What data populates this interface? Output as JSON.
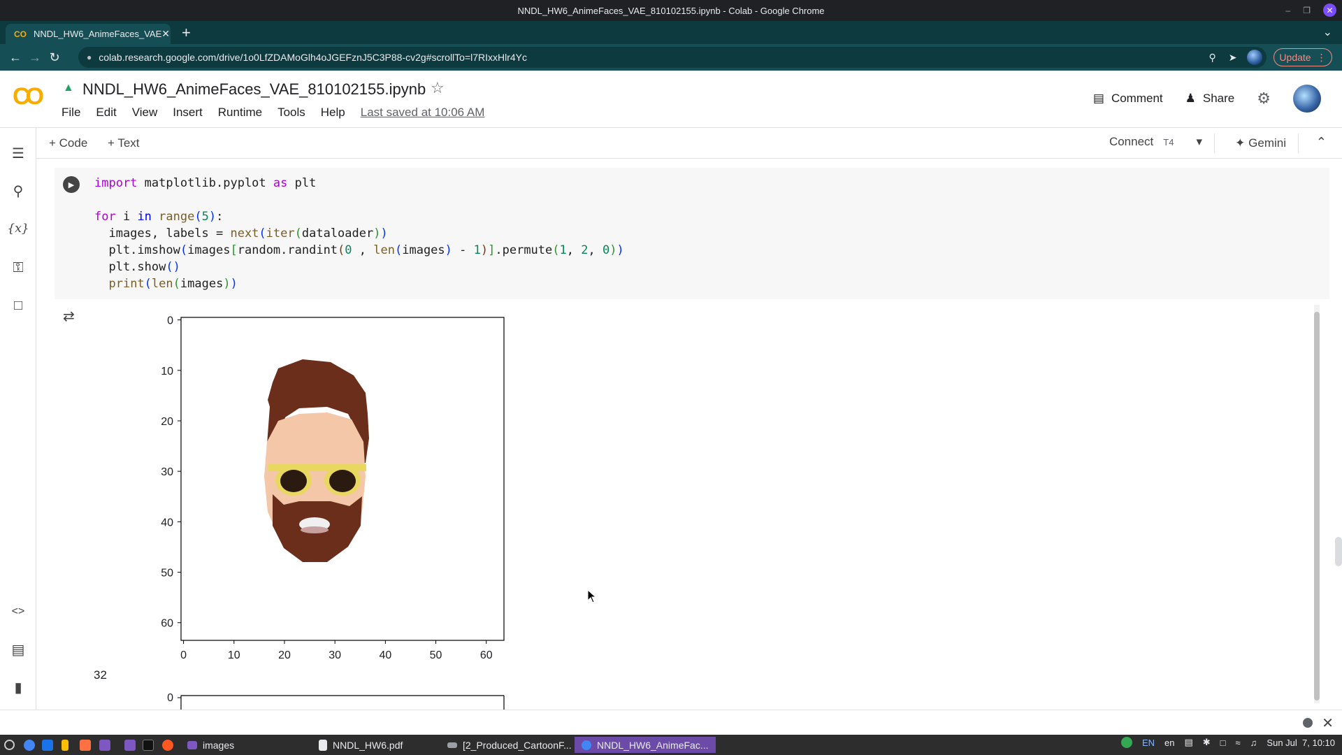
{
  "window": {
    "title": "NNDL_HW6_AnimeFaces_VAE_810102155.ipynb - Colab - Google Chrome",
    "tab_title": "NNDL_HW6_AnimeFaces_VAE",
    "url": "colab.research.google.com/drive/1o0LfZDAMoGlh4oJGEFznJ5C3P88-cv2g#scrollTo=l7RIxxHlr4Yc",
    "update_label": "Update"
  },
  "colab": {
    "notebook_title": "NNDL_HW6_AnimeFaces_VAE_810102155.ipynb",
    "menu": [
      "File",
      "Edit",
      "View",
      "Insert",
      "Runtime",
      "Tools",
      "Help"
    ],
    "last_saved": "Last saved at 10:06 AM",
    "comment_label": "Comment",
    "share_label": "Share"
  },
  "toolbar": {
    "add_code": "+ Code",
    "add_text": "+ Text",
    "connect_label": "Connect",
    "runtime_type": "T4",
    "gemini_label": "Gemini"
  },
  "cell": {
    "code_lines": [
      "import matplotlib.pyplot as plt",
      "",
      "for i in range(5):",
      "  images, labels = next(iter(dataloader))",
      "  plt.imshow(images[random.randint(0 , len(images) - 1)].permute(1, 2, 0))",
      "  plt.show()",
      "  print(len(images))"
    ]
  },
  "chart_data": {
    "type": "heatmap",
    "description_kind": "imshow",
    "xticks": [
      "0",
      "10",
      "20",
      "30",
      "40",
      "50",
      "60"
    ],
    "yticks": [
      "0",
      "10",
      "20",
      "30",
      "40",
      "50",
      "60"
    ],
    "xlim": [
      0,
      63
    ],
    "ylim": [
      63,
      0
    ],
    "second_plot_ytick": "0"
  },
  "output": {
    "printed_value": "32"
  },
  "taskbar": {
    "items": [
      "images",
      "NNDL_HW6.pdf",
      "[2_Produced_CartoonF...",
      "NNDL_HW6_AnimeFac..."
    ],
    "lang1": "EN",
    "lang2": "en",
    "clock": "Sun Jul  7, 10:10"
  },
  "colors": {
    "chrome_tab_bg": "#0d3a3f",
    "chrome_toolbar_bg": "#164e55",
    "colab_logo": "#f9ab00",
    "code_cell_bg": "#f7f7f7",
    "keyword": "#af00db",
    "active_task": "#6b4aa8"
  }
}
